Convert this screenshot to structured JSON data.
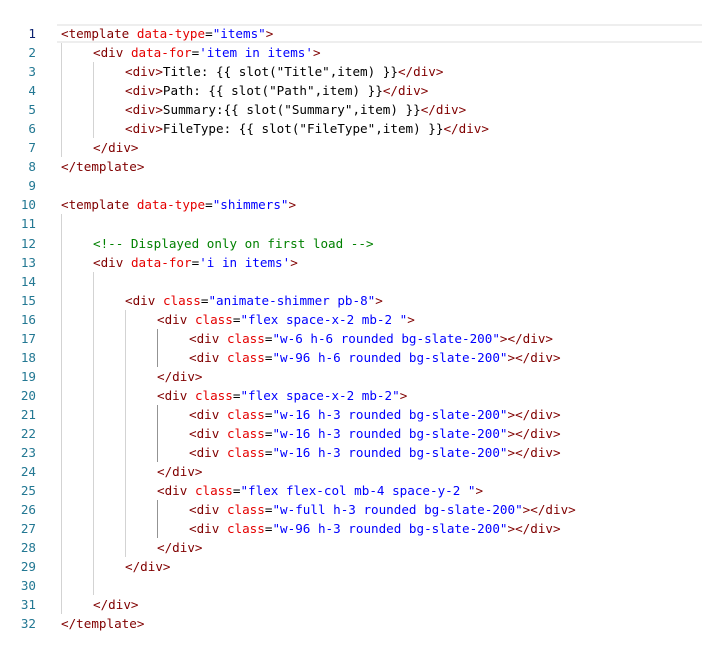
{
  "editor": {
    "language": "html",
    "current_line": 1,
    "colors": {
      "line_number": "#237893",
      "tag": "#800000",
      "attribute": "#e50000",
      "value": "#0000ff",
      "comment": "#008000",
      "text": "#000000"
    },
    "lines": [
      {
        "n": "1",
        "indent": 0,
        "tokens": [
          [
            "tag",
            "<template"
          ],
          [
            "txt",
            " "
          ],
          [
            "attr",
            "data-type"
          ],
          [
            "punc",
            "="
          ],
          [
            "val",
            "\"items\""
          ],
          [
            "tag",
            ">"
          ]
        ]
      },
      {
        "n": "2",
        "indent": 1,
        "tokens": [
          [
            "tag",
            "<div"
          ],
          [
            "txt",
            " "
          ],
          [
            "attr",
            "data-for"
          ],
          [
            "punc",
            "="
          ],
          [
            "val",
            "'item in items'"
          ],
          [
            "tag",
            ">"
          ]
        ]
      },
      {
        "n": "3",
        "indent": 2,
        "tokens": [
          [
            "tag",
            "<div>"
          ],
          [
            "txt",
            "Title: {{ slot(\"Title\",item) }}"
          ],
          [
            "tag",
            "</div>"
          ]
        ]
      },
      {
        "n": "4",
        "indent": 2,
        "tokens": [
          [
            "tag",
            "<div>"
          ],
          [
            "txt",
            "Path: {{ slot(\"Path\",item) }}"
          ],
          [
            "tag",
            "</div>"
          ]
        ]
      },
      {
        "n": "5",
        "indent": 2,
        "tokens": [
          [
            "tag",
            "<div>"
          ],
          [
            "txt",
            "Summary:{{ slot(\"Summary\",item) }}"
          ],
          [
            "tag",
            "</div>"
          ]
        ]
      },
      {
        "n": "6",
        "indent": 2,
        "tokens": [
          [
            "tag",
            "<div>"
          ],
          [
            "txt",
            "FileType: {{ slot(\"FileType\",item) }}"
          ],
          [
            "tag",
            "</div>"
          ]
        ]
      },
      {
        "n": "7",
        "indent": 1,
        "tokens": [
          [
            "tag",
            "</div>"
          ]
        ]
      },
      {
        "n": "8",
        "indent": 0,
        "tokens": [
          [
            "tag",
            "</template>"
          ]
        ]
      },
      {
        "n": "9",
        "indent": 0,
        "tokens": []
      },
      {
        "n": "10",
        "indent": 0,
        "tokens": [
          [
            "tag",
            "<template"
          ],
          [
            "txt",
            " "
          ],
          [
            "attr",
            "data-type"
          ],
          [
            "punc",
            "="
          ],
          [
            "val",
            "\"shimmers\""
          ],
          [
            "tag",
            ">"
          ]
        ]
      },
      {
        "n": "11",
        "indent": 1,
        "tokens": []
      },
      {
        "n": "12",
        "indent": 1,
        "tokens": [
          [
            "com",
            "<!-- Displayed only on first load -->"
          ]
        ]
      },
      {
        "n": "13",
        "indent": 1,
        "tokens": [
          [
            "tag",
            "<div"
          ],
          [
            "txt",
            " "
          ],
          [
            "attr",
            "data-for"
          ],
          [
            "punc",
            "="
          ],
          [
            "val",
            "'i in items'"
          ],
          [
            "tag",
            ">"
          ]
        ]
      },
      {
        "n": "14",
        "indent": 2,
        "tokens": []
      },
      {
        "n": "15",
        "indent": 2,
        "tokens": [
          [
            "tag",
            "<div"
          ],
          [
            "txt",
            " "
          ],
          [
            "attr",
            "class"
          ],
          [
            "punc",
            "="
          ],
          [
            "val",
            "\"animate-shimmer pb-8\""
          ],
          [
            "tag",
            ">"
          ]
        ]
      },
      {
        "n": "16",
        "indent": 3,
        "tokens": [
          [
            "tag",
            "<div"
          ],
          [
            "txt",
            " "
          ],
          [
            "attr",
            "class"
          ],
          [
            "punc",
            "="
          ],
          [
            "val",
            "\"flex space-x-2 mb-2 \""
          ],
          [
            "tag",
            ">"
          ]
        ]
      },
      {
        "n": "17",
        "indent": 4,
        "tokens": [
          [
            "tag",
            "<div"
          ],
          [
            "txt",
            " "
          ],
          [
            "attr",
            "class"
          ],
          [
            "punc",
            "="
          ],
          [
            "val",
            "\"w-6 h-6 rounded bg-slate-200\""
          ],
          [
            "tag",
            "></div>"
          ]
        ]
      },
      {
        "n": "18",
        "indent": 4,
        "tokens": [
          [
            "tag",
            "<div"
          ],
          [
            "txt",
            " "
          ],
          [
            "attr",
            "class"
          ],
          [
            "punc",
            "="
          ],
          [
            "val",
            "\"w-96 h-6 rounded bg-slate-200\""
          ],
          [
            "tag",
            "></div>"
          ]
        ]
      },
      {
        "n": "19",
        "indent": 3,
        "tokens": [
          [
            "tag",
            "</div>"
          ]
        ]
      },
      {
        "n": "20",
        "indent": 3,
        "tokens": [
          [
            "tag",
            "<div"
          ],
          [
            "txt",
            " "
          ],
          [
            "attr",
            "class"
          ],
          [
            "punc",
            "="
          ],
          [
            "val",
            "\"flex space-x-2 mb-2\""
          ],
          [
            "tag",
            ">"
          ]
        ]
      },
      {
        "n": "21",
        "indent": 4,
        "tokens": [
          [
            "tag",
            "<div"
          ],
          [
            "txt",
            " "
          ],
          [
            "attr",
            "class"
          ],
          [
            "punc",
            "="
          ],
          [
            "val",
            "\"w-16 h-3 rounded bg-slate-200\""
          ],
          [
            "tag",
            "></div>"
          ]
        ]
      },
      {
        "n": "22",
        "indent": 4,
        "tokens": [
          [
            "tag",
            "<div"
          ],
          [
            "txt",
            " "
          ],
          [
            "attr",
            "class"
          ],
          [
            "punc",
            "="
          ],
          [
            "val",
            "\"w-16 h-3 rounded bg-slate-200\""
          ],
          [
            "tag",
            "></div>"
          ]
        ]
      },
      {
        "n": "23",
        "indent": 4,
        "tokens": [
          [
            "tag",
            "<div"
          ],
          [
            "txt",
            " "
          ],
          [
            "attr",
            "class"
          ],
          [
            "punc",
            "="
          ],
          [
            "val",
            "\"w-16 h-3 rounded bg-slate-200\""
          ],
          [
            "tag",
            "></div>"
          ]
        ]
      },
      {
        "n": "24",
        "indent": 3,
        "tokens": [
          [
            "tag",
            "</div>"
          ]
        ]
      },
      {
        "n": "25",
        "indent": 3,
        "tokens": [
          [
            "tag",
            "<div"
          ],
          [
            "txt",
            " "
          ],
          [
            "attr",
            "class"
          ],
          [
            "punc",
            "="
          ],
          [
            "val",
            "\"flex flex-col mb-4 space-y-2 \""
          ],
          [
            "tag",
            ">"
          ]
        ]
      },
      {
        "n": "26",
        "indent": 4,
        "tokens": [
          [
            "tag",
            "<div"
          ],
          [
            "txt",
            " "
          ],
          [
            "attr",
            "class"
          ],
          [
            "punc",
            "="
          ],
          [
            "val",
            "\"w-full h-3 rounded bg-slate-200\""
          ],
          [
            "tag",
            "></div>"
          ]
        ]
      },
      {
        "n": "27",
        "indent": 4,
        "tokens": [
          [
            "tag",
            "<div"
          ],
          [
            "txt",
            " "
          ],
          [
            "attr",
            "class"
          ],
          [
            "punc",
            "="
          ],
          [
            "val",
            "\"w-96 h-3 rounded bg-slate-200\""
          ],
          [
            "tag",
            "></div>"
          ]
        ]
      },
      {
        "n": "28",
        "indent": 3,
        "tokens": [
          [
            "tag",
            "</div>"
          ]
        ]
      },
      {
        "n": "29",
        "indent": 2,
        "tokens": [
          [
            "tag",
            "</div>"
          ]
        ]
      },
      {
        "n": "30",
        "indent": 2,
        "tokens": []
      },
      {
        "n": "31",
        "indent": 1,
        "tokens": [
          [
            "tag",
            "</div>"
          ]
        ]
      },
      {
        "n": "32",
        "indent": 0,
        "tokens": [
          [
            "tag",
            "</template>"
          ]
        ]
      }
    ]
  }
}
